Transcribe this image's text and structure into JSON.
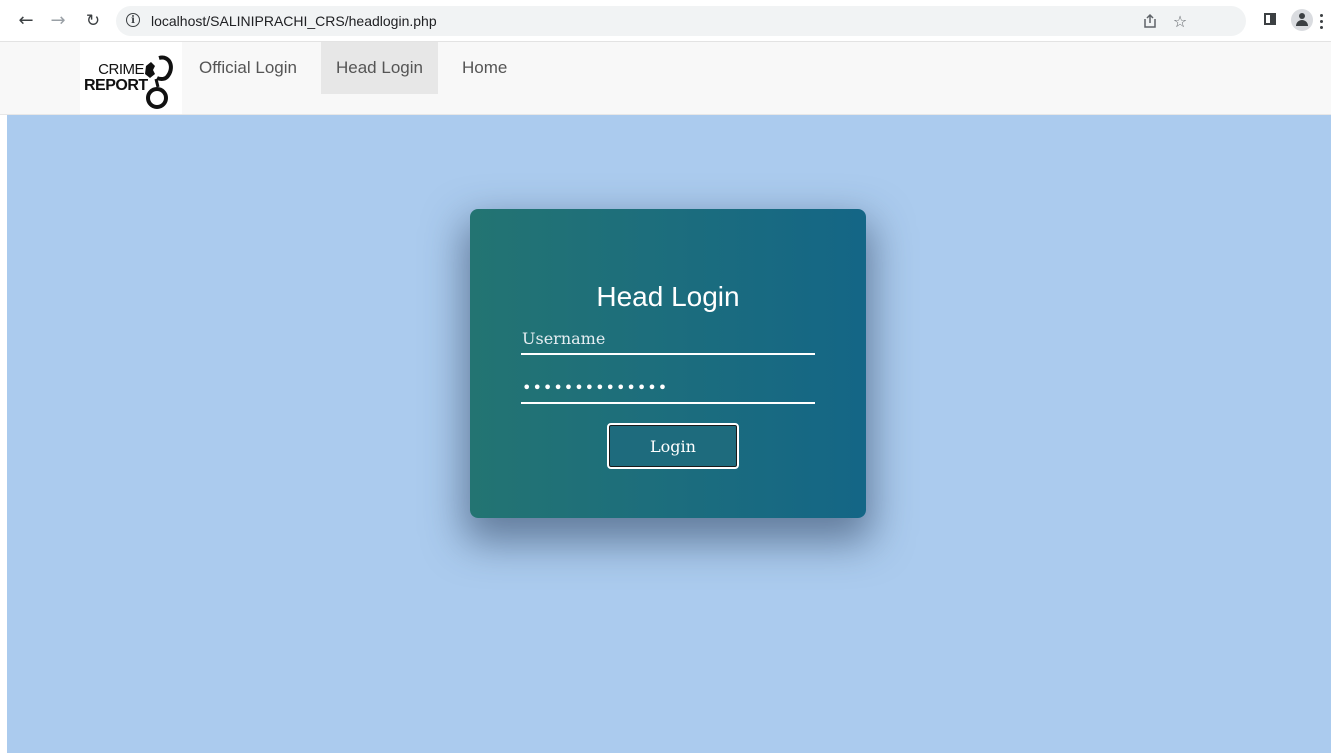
{
  "browser": {
    "url": "localhost/SALINIPRACHI_CRS/headlogin.php",
    "icons": [
      "back-arrow-icon",
      "forward-arrow-icon",
      "reload-icon",
      "info-icon",
      "share-icon",
      "star-icon",
      "side-panel-icon",
      "profile-icon",
      "menu-icon"
    ]
  },
  "navbar": {
    "logo_line1": "CRIME",
    "logo_line2": "REPORT",
    "links": [
      {
        "label": "Official Login"
      },
      {
        "label": "Head Login",
        "active": true
      },
      {
        "label": "Home"
      }
    ]
  },
  "login_form": {
    "title": "Head Login",
    "username_placeholder": "Username",
    "password_value": "••••••••••••••",
    "submit_label": "Login"
  },
  "colors": {
    "page_background": "#abcbee",
    "card_gradient_start": "#237472",
    "card_gradient_end": "#146686",
    "navbar_background": "#f8f8f8",
    "active_link_background": "#e7e7e7"
  }
}
